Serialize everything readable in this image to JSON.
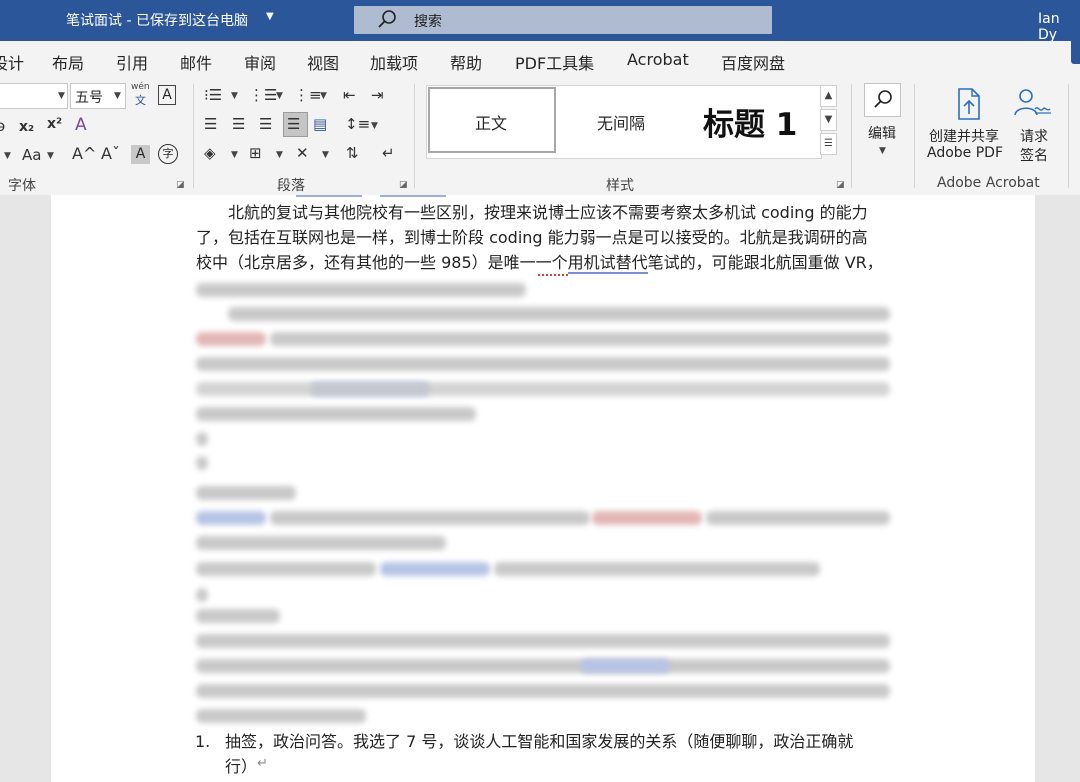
{
  "titlebar": {
    "doc_title": "笔试面试 - 已保存到这台电脑",
    "search_placeholder": "搜索",
    "user_name": "Ian Dy"
  },
  "tabs": [
    "设计",
    "布局",
    "引用",
    "邮件",
    "审阅",
    "视图",
    "加载项",
    "帮助",
    "PDF工具集",
    "Acrobat",
    "百度网盘"
  ],
  "ribbon": {
    "font": {
      "size_value": "五号",
      "phonetic_top": "wén",
      "phonetic_bottom": "文",
      "bordered_char": "A",
      "subscript": "x₂",
      "superscript": "x²",
      "change_case": "Aa",
      "grow": "A^",
      "shrink": "Aˇ",
      "shade_char": "A",
      "enclose_char": "字",
      "group_label": "字体"
    },
    "paragraph": {
      "group_label": "段落"
    },
    "styles": {
      "items": [
        "正文",
        "无间隔",
        "标题 1"
      ],
      "group_label": "样式"
    },
    "editing": {
      "label": "编辑"
    },
    "acrobat": {
      "create_share_line1": "创建并共享",
      "create_share_line2": "Adobe PDF",
      "request_sign_line1": "请求",
      "request_sign_line2": "签名",
      "group_label": "Adobe Acrobat"
    }
  },
  "document": {
    "paragraph1": [
      "　　北航的复试与其他院校有一些区别，按理来说博士应该不需要考察太多机试 coding 的能力",
      "了，包括在互联网也是一样，到博士阶段 coding 能力弱一点是可以接受的。北航是我调研的高",
      "校中（北京居多，还有其他的一些 985）是唯一一个用机试替代笔试的，可能跟北航国重做 VR，"
    ],
    "list_item": {
      "number": "1.",
      "line1": "抽签，政治问答。我选了 7 号，谈谈人工智能和国家发展的关系（随便聊聊，政治正确就",
      "line2": "行）",
      "para_mark": "↵"
    }
  }
}
